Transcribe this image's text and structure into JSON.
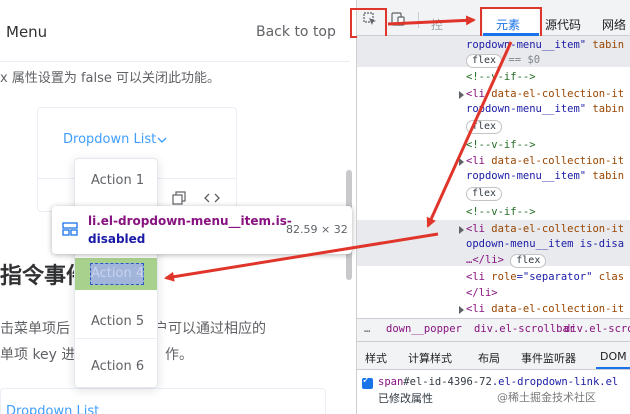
{
  "page": {
    "menu_label": "Menu",
    "back_to_top": "Back to top",
    "para1": "x 属性设置为 false 可以关闭此功能。",
    "dropdown_link": "Dropdown List",
    "section_title": "指令事件",
    "para2_left": "击菜单项后",
    "para2_right": "用户可以通过相应的",
    "para3_left": "单项 key 进",
    "para3_right": "作。",
    "bottom_link": "Dropdown List"
  },
  "dropdown": {
    "items": [
      "Action 1",
      "Action 5",
      "Action 6"
    ],
    "highlighted": "Action 4"
  },
  "tooltip": {
    "selector_line1": "li.el-dropdown-menu__item.is-",
    "selector_line2": "disabled",
    "size": "82.59 × 32"
  },
  "devtools": {
    "tabs": {
      "elements_prev": "控",
      "elements": "元素",
      "sources": "源代码",
      "network": "网络"
    },
    "dom_lines": {
      "l1_val": "ropdown-menu__item\"",
      "l1_attr": " tabin",
      "l2_badge": "flex",
      "l2_eq": " == $0",
      "comment": "<!--v-if-->",
      "li_open": "<li ",
      "li_attr": "data-el-collection-it",
      "l4_val": "ropdown-menu__item\"",
      "l4_attr": " tabin",
      "l8_val": "ropdown-menu__item\"",
      "l8_attr": " tabin",
      "l12_val": "opdown-menu__item is-disa",
      "l13_text": "…</li>",
      "l13_badge": "flex",
      "sep_open": "<li ",
      "sep_attr": "role",
      "sep_val": "=\"separator\"",
      "sep_rest": " clas",
      "li_close": "</li>",
      "flex": "flex"
    },
    "breadcrumbs": [
      "…",
      "down__popper",
      "div.el-scrollbar",
      "div.el-scrollb"
    ],
    "style_tabs": [
      "样式",
      "计算样式",
      "布局",
      "事件监听器",
      "DOM"
    ],
    "span_tag": "span",
    "span_id": "#el-id-4396-72",
    "span_class": ".el-dropdown-link.el",
    "modified_label": "已修改属性",
    "watermark": "@稀土掘金技术社区"
  },
  "colors": {
    "accent_blue": "#409eff",
    "annotation_red": "#e0352b",
    "highlight_green": "#a9d18e",
    "devtools_blue": "#1a73e8"
  }
}
